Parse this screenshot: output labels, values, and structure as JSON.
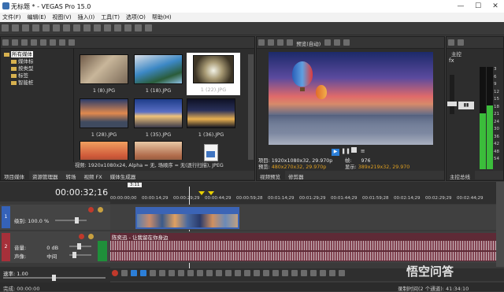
{
  "window": {
    "title": "无标题 * - VEGAS Pro 15.0",
    "min": "—",
    "max": "☐",
    "close": "✕"
  },
  "menu": [
    "文件(F)",
    "编辑(E)",
    "视图(V)",
    "插入(I)",
    "工具(T)",
    "选项(O)",
    "帮助(H)"
  ],
  "media": {
    "tree": [
      {
        "label": "所有媒体",
        "selected": true
      },
      {
        "label": "媒体标",
        "selected": false
      },
      {
        "label": "按类型",
        "selected": false
      },
      {
        "label": "标签",
        "selected": false
      },
      {
        "label": "智能桩",
        "selected": false
      }
    ],
    "thumbs": [
      {
        "caption": "1 (8).JPG"
      },
      {
        "caption": "1 (18).JPG"
      },
      {
        "caption": "1 (22).JPG"
      },
      {
        "caption": "1 (28).JPG"
      },
      {
        "caption": "1 (35).JPG"
      },
      {
        "caption": "1 (36).JPG"
      },
      {
        "caption": ""
      },
      {
        "caption": ""
      },
      {
        "caption": ""
      }
    ],
    "status": "视频: 1920x1080x24, Alpha = 无, 场顺序 = 无(逐行扫描), JPEG",
    "tabs": [
      "项目媒体",
      "资源管理器",
      "转场",
      "视频 FX",
      "媒体生成器"
    ]
  },
  "preview": {
    "toolbar_label": "预览(自动)",
    "project_label": "项目:",
    "project_value": "1920x1080x32, 29.970p",
    "preview_label": "预览:",
    "preview_value": "480x270x32, 29.970p",
    "frame_label": "帧:",
    "frame_value": "976",
    "display_label": "显示:",
    "display_value": "389x219x32, 29.970",
    "tabs": [
      "视频预览",
      "修剪器"
    ]
  },
  "master": {
    "title": "主控",
    "tab": "主控总线",
    "scale": [
      "3",
      "6",
      "9",
      "12",
      "15",
      "18",
      "21",
      "24",
      "30",
      "36",
      "42",
      "48",
      "54"
    ],
    "levels": [
      0.55,
      0.62
    ]
  },
  "timeline": {
    "timecode": "00:00:32;16",
    "ruler": [
      "00:00:00;00",
      "00:00:14;29",
      "00:00:29;29",
      "00:00:44;29",
      "00:00:59;28",
      "00:01:14;29",
      "00:01:29;29",
      "00:01:44;29",
      "00:01:59;28",
      "00:02:14;29",
      "00:02:29;29",
      "00:02:44;29"
    ],
    "marker": "3:11",
    "video_track": {
      "num": "1",
      "level_label": "级别:",
      "level_value": "100.0 %"
    },
    "audio_track": {
      "num": "2",
      "vol_label": "音量:",
      "vol_value": "0 dB",
      "pan_label": "声像:",
      "pan_value": "中间",
      "clip_title": "陈奕迅 - 让我留在你身边"
    },
    "rate_label": "速率:",
    "rate_value": "1.00"
  },
  "statusbar": {
    "left": "完成: 00:00:00",
    "right": "录制时间(2 个通道): 41:34:10"
  },
  "watermark": "悟空问答"
}
